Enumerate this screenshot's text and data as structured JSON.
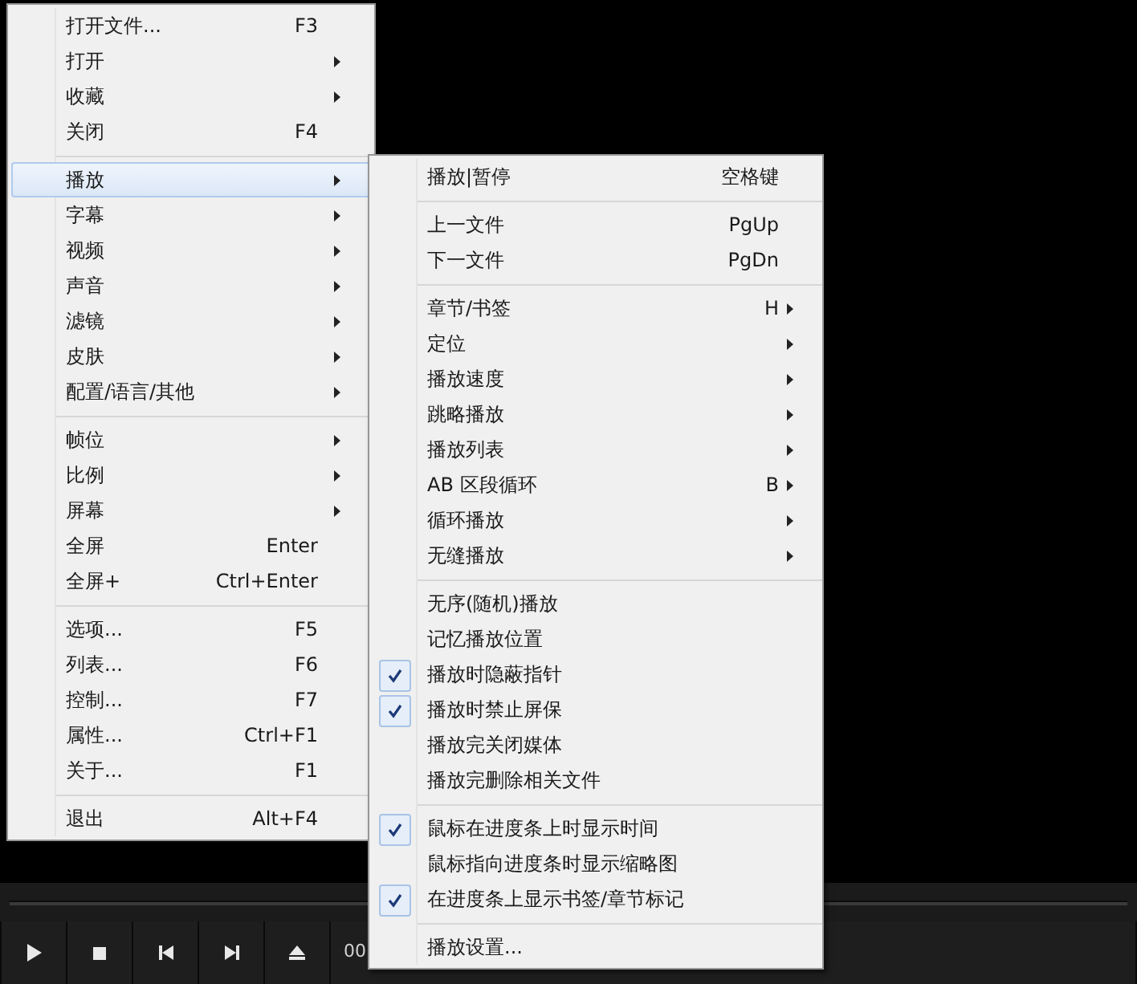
{
  "main_menu": [
    {
      "kind": "item",
      "label": "打开文件...",
      "shortcut": "F3",
      "submenu": false,
      "selected": false
    },
    {
      "kind": "item",
      "label": "打开",
      "submenu": true,
      "selected": false
    },
    {
      "kind": "item",
      "label": "收藏",
      "submenu": true,
      "selected": false
    },
    {
      "kind": "item",
      "label": "关闭",
      "shortcut": "F4",
      "submenu": false,
      "selected": false
    },
    {
      "kind": "separator"
    },
    {
      "kind": "item",
      "label": "播放",
      "submenu": true,
      "selected": true
    },
    {
      "kind": "item",
      "label": "字幕",
      "submenu": true,
      "selected": false
    },
    {
      "kind": "item",
      "label": "视频",
      "submenu": true,
      "selected": false
    },
    {
      "kind": "item",
      "label": "声音",
      "submenu": true,
      "selected": false
    },
    {
      "kind": "item",
      "label": "滤镜",
      "submenu": true,
      "selected": false
    },
    {
      "kind": "item",
      "label": "皮肤",
      "submenu": true,
      "selected": false
    },
    {
      "kind": "item",
      "label": "配置/语言/其他",
      "submenu": true,
      "selected": false
    },
    {
      "kind": "separator"
    },
    {
      "kind": "item",
      "label": "帧位",
      "submenu": true,
      "selected": false
    },
    {
      "kind": "item",
      "label": "比例",
      "submenu": true,
      "selected": false
    },
    {
      "kind": "item",
      "label": "屏幕",
      "submenu": true,
      "selected": false
    },
    {
      "kind": "item",
      "label": "全屏",
      "shortcut": "Enter",
      "submenu": false,
      "selected": false
    },
    {
      "kind": "item",
      "label": "全屏+",
      "shortcut": "Ctrl+Enter",
      "submenu": false,
      "selected": false
    },
    {
      "kind": "separator"
    },
    {
      "kind": "item",
      "label": "选项...",
      "shortcut": "F5",
      "submenu": false,
      "selected": false
    },
    {
      "kind": "item",
      "label": "列表...",
      "shortcut": "F6",
      "submenu": false,
      "selected": false
    },
    {
      "kind": "item",
      "label": "控制...",
      "shortcut": "F7",
      "submenu": false,
      "selected": false
    },
    {
      "kind": "item",
      "label": "属性...",
      "shortcut": "Ctrl+F1",
      "submenu": false,
      "selected": false
    },
    {
      "kind": "item",
      "label": "关于...",
      "shortcut": "F1",
      "submenu": false,
      "selected": false
    },
    {
      "kind": "separator"
    },
    {
      "kind": "item",
      "label": "退出",
      "shortcut": "Alt+F4",
      "submenu": false,
      "selected": false
    }
  ],
  "play_submenu": [
    {
      "kind": "item",
      "label": "播放|暂停",
      "shortcut": "空格键",
      "submenu": false,
      "checked": false
    },
    {
      "kind": "separator"
    },
    {
      "kind": "item",
      "label": "上一文件",
      "shortcut": "PgUp",
      "submenu": false,
      "checked": false
    },
    {
      "kind": "item",
      "label": "下一文件",
      "shortcut": "PgDn",
      "submenu": false,
      "checked": false
    },
    {
      "kind": "separator"
    },
    {
      "kind": "item",
      "label": "章节/书签",
      "shortcut": "H",
      "submenu": true,
      "checked": false
    },
    {
      "kind": "item",
      "label": "定位",
      "submenu": true,
      "checked": false
    },
    {
      "kind": "item",
      "label": "播放速度",
      "submenu": true,
      "checked": false
    },
    {
      "kind": "item",
      "label": "跳略播放",
      "submenu": true,
      "checked": false
    },
    {
      "kind": "item",
      "label": "播放列表",
      "submenu": true,
      "checked": false
    },
    {
      "kind": "item",
      "label": "AB 区段循环",
      "shortcut": "B",
      "submenu": true,
      "checked": false
    },
    {
      "kind": "item",
      "label": "循环播放",
      "submenu": true,
      "checked": false
    },
    {
      "kind": "item",
      "label": "无缝播放",
      "submenu": true,
      "checked": false
    },
    {
      "kind": "separator"
    },
    {
      "kind": "item",
      "label": "无序(随机)播放",
      "submenu": false,
      "checked": false
    },
    {
      "kind": "item",
      "label": "记忆播放位置",
      "submenu": false,
      "checked": false
    },
    {
      "kind": "item",
      "label": "播放时隐蔽指针",
      "submenu": false,
      "checked": true
    },
    {
      "kind": "item",
      "label": "播放时禁止屏保",
      "submenu": false,
      "checked": true
    },
    {
      "kind": "item",
      "label": "播放完关闭媒体",
      "submenu": false,
      "checked": false
    },
    {
      "kind": "item",
      "label": "播放完删除相关文件",
      "submenu": false,
      "checked": false
    },
    {
      "kind": "separator"
    },
    {
      "kind": "item",
      "label": "鼠标在进度条上时显示时间",
      "submenu": false,
      "checked": true
    },
    {
      "kind": "item",
      "label": "鼠标指向进度条时显示缩略图",
      "submenu": false,
      "checked": false
    },
    {
      "kind": "item",
      "label": "在进度条上显示书签/章节标记",
      "submenu": false,
      "checked": true
    },
    {
      "kind": "separator"
    },
    {
      "kind": "item",
      "label": "播放设置...",
      "submenu": false,
      "checked": false
    }
  ],
  "control_bar": {
    "buttons": [
      {
        "kind": "play"
      },
      {
        "kind": "stop"
      },
      {
        "kind": "previous"
      },
      {
        "kind": "next"
      },
      {
        "kind": "eject"
      }
    ],
    "time": "00"
  }
}
